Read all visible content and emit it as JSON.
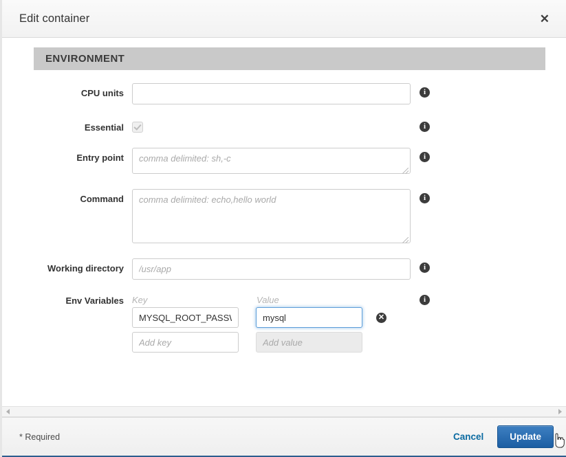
{
  "dialog": {
    "title": "Edit container",
    "close_icon": "close-icon"
  },
  "section": {
    "heading": "ENVIRONMENT"
  },
  "fields": {
    "cpu_units": {
      "label": "CPU units",
      "value": "",
      "placeholder": "",
      "info_icon": "info-icon"
    },
    "essential": {
      "label": "Essential",
      "checked": "true",
      "disabled": "true",
      "info_icon": "info-icon"
    },
    "entry_point": {
      "label": "Entry point",
      "value": "",
      "placeholder": "comma delimited: sh,-c",
      "info_icon": "info-icon"
    },
    "command": {
      "label": "Command",
      "value": "",
      "placeholder": "comma delimited: echo,hello world",
      "info_icon": "info-icon"
    },
    "working_directory": {
      "label": "Working directory",
      "value": "",
      "placeholder": "/usr/app",
      "info_icon": "info-icon"
    },
    "env_variables": {
      "label": "Env Variables",
      "key_header": "Key",
      "value_header": "Value",
      "info_icon": "info-icon",
      "rows": [
        {
          "key_value": "MYSQL_ROOT_PASSWORD",
          "key_placeholder": "",
          "value_value": "mysql",
          "value_placeholder": "",
          "remove_icon": "remove-icon"
        },
        {
          "key_value": "",
          "key_placeholder": "Add key",
          "value_value": "",
          "value_placeholder": "Add value",
          "remove_icon": ""
        }
      ]
    }
  },
  "scrollbar": {
    "left_arrow_icon": "chevron-left-icon",
    "right_arrow_icon": "chevron-right-icon"
  },
  "footer": {
    "required_note": "* Required",
    "cancel_label": "Cancel",
    "update_label": "Update"
  },
  "colors": {
    "accent": "#1c5ea3",
    "link": "#0a6aa1",
    "section_bar": "#c9c9c9",
    "focus_ring": "#5b9dd9",
    "footer_rule": "#2d5d8e"
  }
}
